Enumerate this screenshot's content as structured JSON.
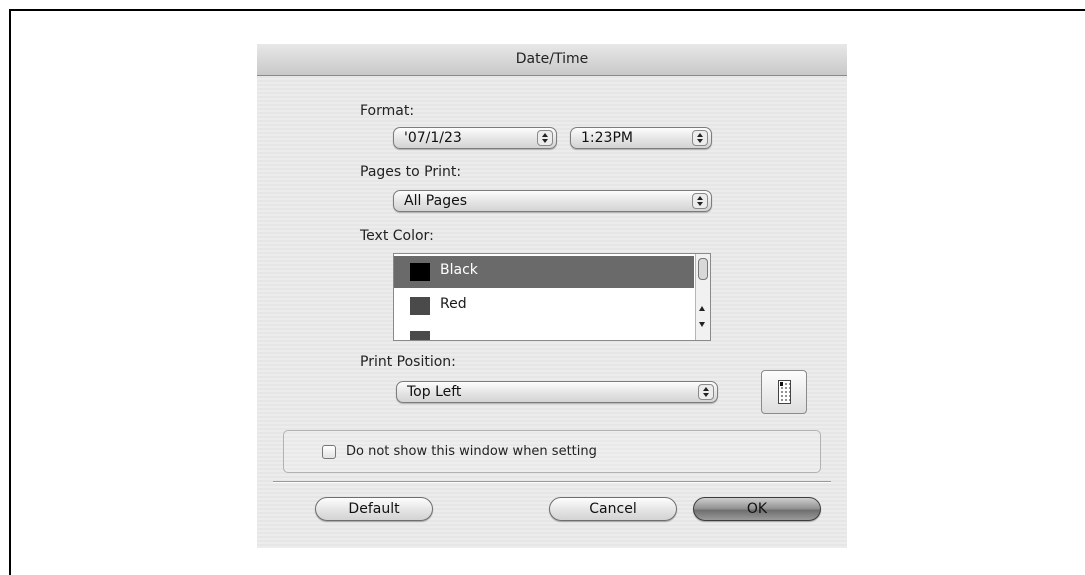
{
  "dialog": {
    "title": "Date/Time"
  },
  "format": {
    "label": "Format:",
    "date_value": "'07/1/23",
    "time_value": "1:23PM"
  },
  "pages": {
    "label": "Pages to Print:",
    "value": "All Pages"
  },
  "text_color": {
    "label": "Text Color:",
    "items": [
      {
        "label": "Black",
        "color": "#000000",
        "selected": true
      },
      {
        "label": "Red",
        "color": "#4a4a4a",
        "selected": false
      }
    ]
  },
  "print_position": {
    "label": "Print Position:",
    "value": "Top Left",
    "icon": "page-position-icon"
  },
  "checkbox": {
    "label": "Do not show this window when setting",
    "checked": false
  },
  "buttons": {
    "default_label": "Default",
    "cancel_label": "Cancel",
    "ok_label": "OK"
  }
}
